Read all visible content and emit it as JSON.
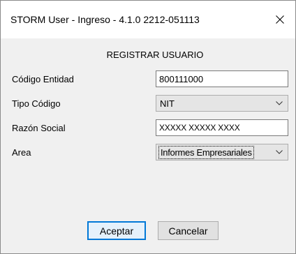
{
  "window": {
    "title": "STORM User - Ingreso - 4.1.0  2212-051113"
  },
  "form": {
    "heading": "REGISTRAR USUARIO",
    "fields": [
      {
        "label": "Código Entidad",
        "value": "800111000"
      },
      {
        "label": "Tipo Código",
        "value": "NIT"
      },
      {
        "label": "Razón Social",
        "value": "XXXXX XXXXX XXXX"
      },
      {
        "label": "Area",
        "value": "Informes Empresariales"
      }
    ]
  },
  "buttons": {
    "accept": "Aceptar",
    "cancel": "Cancelar"
  },
  "icons": {
    "close": "close-icon",
    "dropdown": "chevron-down-icon"
  },
  "colors": {
    "accent": "#0078d7",
    "window_bg": "#f0f0f0",
    "titlebar_bg": "#ffffff"
  }
}
